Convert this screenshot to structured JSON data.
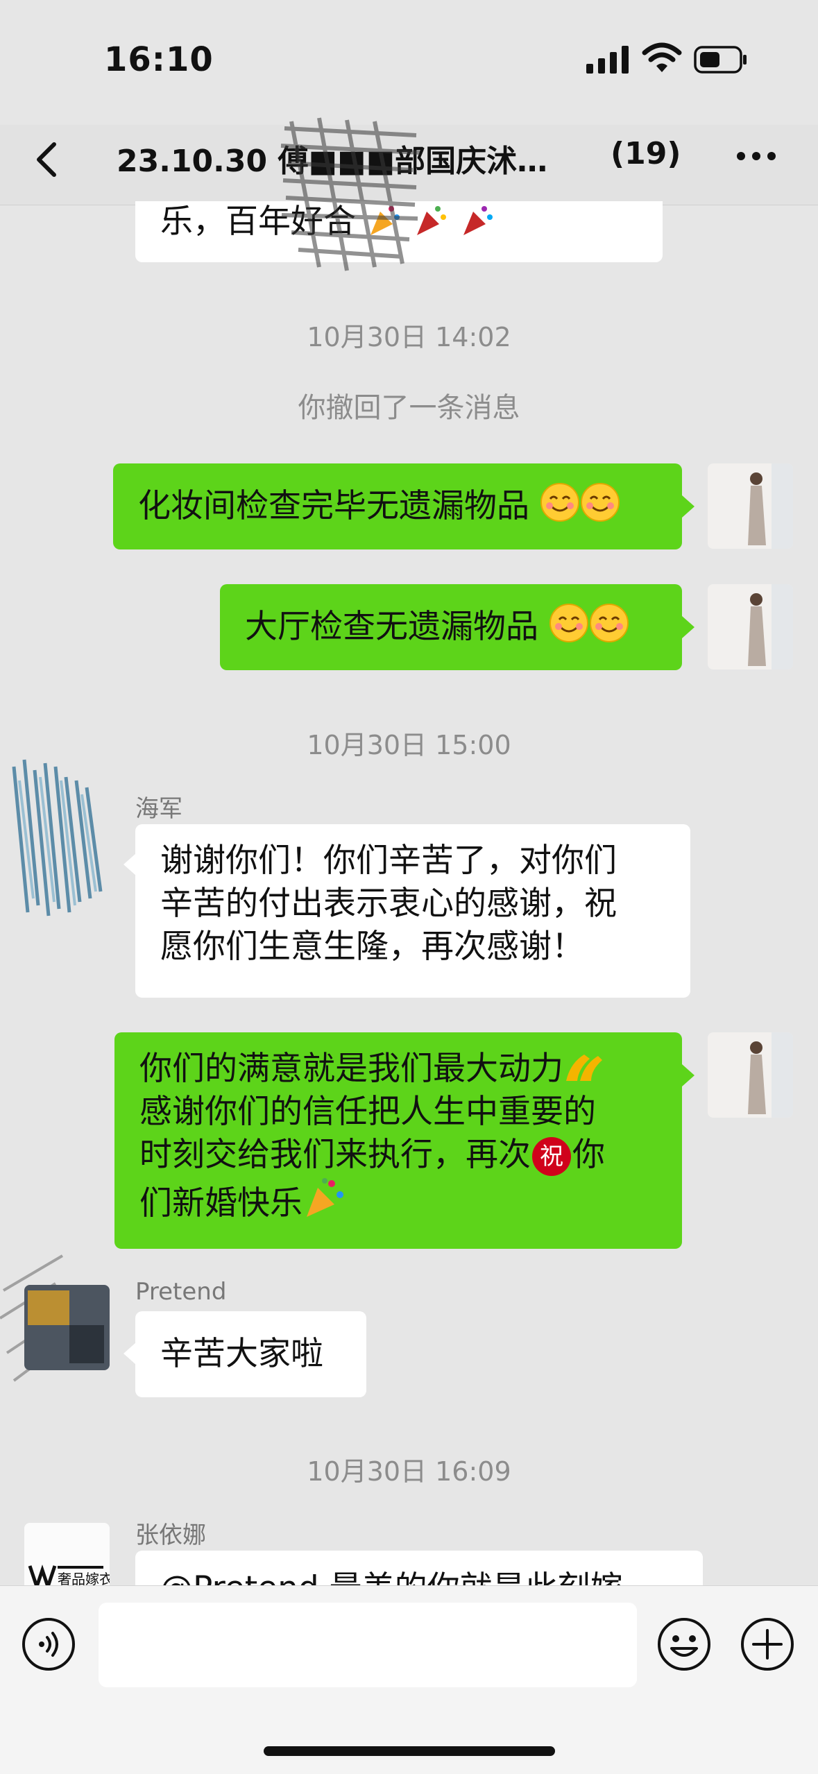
{
  "status_bar": {
    "time": "16:10"
  },
  "header": {
    "title": "23.10.30 傅■■■部国庆沭…",
    "member_count": "(19)"
  },
  "messages": {
    "partial_top": {
      "text": "乐，百年好合"
    },
    "ts1": "10月30日 14:02",
    "system1": "你撤回了一条消息",
    "m1": {
      "text": "化妆间检查完毕无遗漏物品"
    },
    "m2": {
      "text": "大厅检查无遗漏物品"
    },
    "ts2": "10月30日 15:00",
    "m3": {
      "sender": "海军",
      "lines": [
        "谢谢你们！你们辛苦了，对你们",
        "辛苦的付出表示衷心的感谢，祝",
        "愿你们生意生隆，再次感谢！"
      ]
    },
    "m4": {
      "line1": "你们的满意就是我们最大动力",
      "line2": "感谢你们的信任把人生中重要的",
      "line3a": "时刻交给我们来执行，再次",
      "badge": "祝",
      "line3b": "你",
      "line4": "们新婚快乐"
    },
    "m5": {
      "sender": "Pretend",
      "text": "辛苦大家啦"
    },
    "ts3": "10月30日 16:09",
    "m6": {
      "sender": "张依娜",
      "text": "@Pretend 最美的你就是此刻嫁"
    }
  },
  "avatar_labels": {
    "brand": "奢品嫁衣"
  },
  "colors": {
    "green_bubble": "#5dd41a",
    "background": "#e6e6e6",
    "badge_red": "#d0021b"
  }
}
